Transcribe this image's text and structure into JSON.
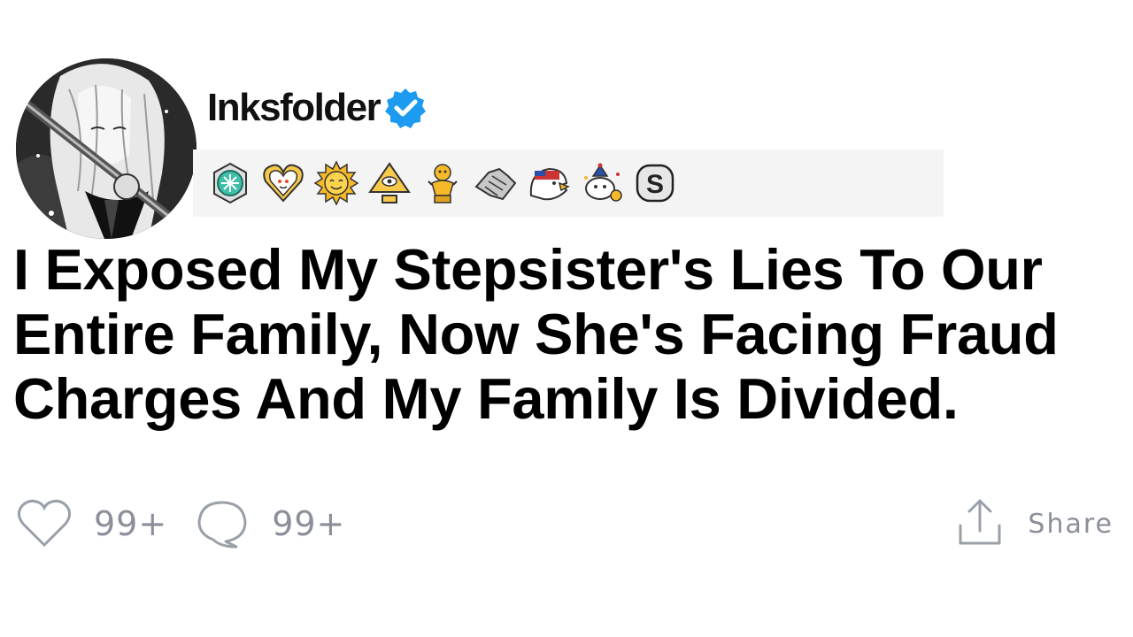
{
  "post": {
    "username": "Inksfolder",
    "verified": true,
    "title": "I Exposed My Stepsister's Lies To Our Entire Family, Now She's Facing Fraud Charges And My Family Is Divided.",
    "awards": [
      "helpful-award-icon",
      "wholesome-heart-award-icon",
      "sun-award-icon",
      "illuminati-pyramid-award-icon",
      "gold-trophy-award-icon",
      "handshake-award-icon",
      "eagle-flag-award-icon",
      "snoo-party-award-icon",
      "silver-s-award-icon"
    ]
  },
  "actions": {
    "likes_count": "99+",
    "comments_count": "99+",
    "share_label": "Share"
  },
  "colors": {
    "verified_blue": "#1d9bf0",
    "muted_gray": "#8a8f99",
    "awards_bg": "#f4f4f4"
  }
}
